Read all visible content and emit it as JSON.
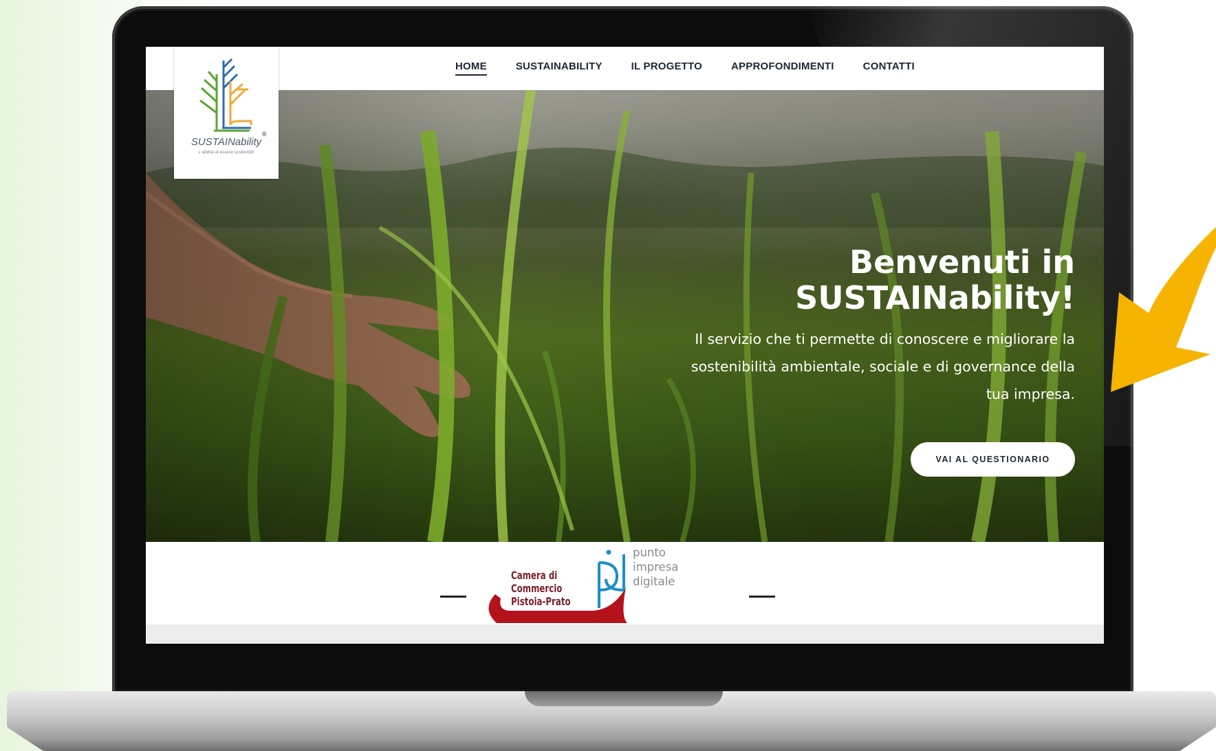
{
  "nav": {
    "items": [
      {
        "label": "HOME",
        "active": true
      },
      {
        "label": "SUSTAINABILITY",
        "active": false
      },
      {
        "label": "IL PROGETTO",
        "active": false
      },
      {
        "label": "APPROFONDIMENTI",
        "active": false
      },
      {
        "label": "CONTATTI",
        "active": false
      }
    ]
  },
  "logo": {
    "name": "SUSTAINability",
    "tagline": "L'abilità di essere sostenibili",
    "registered_mark": "®"
  },
  "hero": {
    "title_line1": "Benvenuti in",
    "title_line2": "SUSTAINability!",
    "subtitle_line1": "Il servizio che ti permette di conoscere e migliorare la",
    "subtitle_line2": "sostenibilità ambientale, sociale e di governance della",
    "subtitle_line3": "tua impresa.",
    "cta_label": "VAI AL QUESTIONARIO"
  },
  "partners": {
    "chamber_line1": "Camera di Commercio",
    "chamber_line2": "Pistoia-Prato",
    "pid_line1": "punto",
    "pid_line2": "impresa",
    "pid_line3": "digitale"
  },
  "colors": {
    "nav_text": "#1d2733",
    "accent_arrow": "#f6b400",
    "chamber_red": "#b5121b",
    "pid_blue": "#1a8fc9",
    "tree_green": "#5aa532",
    "tree_blue": "#2b6cb0",
    "tree_orange": "#f2a93b"
  }
}
